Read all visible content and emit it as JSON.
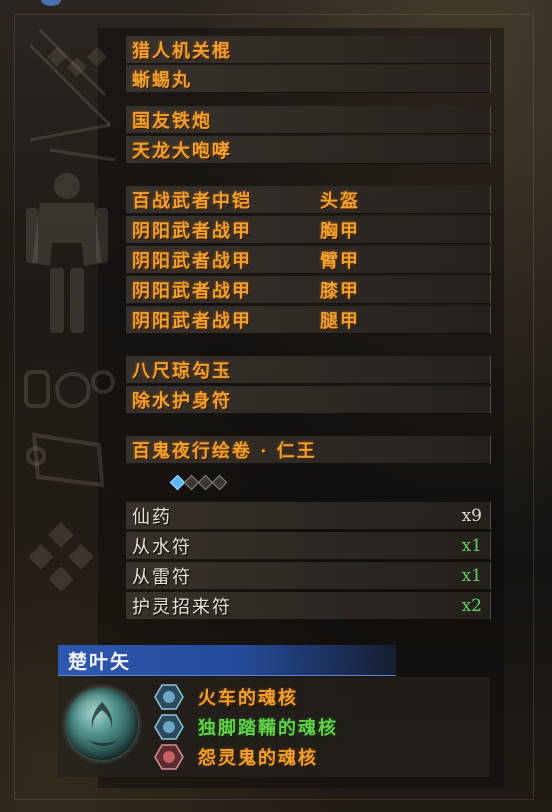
{
  "equipment": {
    "weapons_1": [
      "猎人机关棍",
      "蜥蜴丸"
    ],
    "weapons_2": [
      "国友铁炮",
      "天龙大咆哮"
    ],
    "armor": [
      {
        "name": "百战武者中铠",
        "slot": "头盔"
      },
      {
        "name": "阴阳武者战甲",
        "slot": "胸甲"
      },
      {
        "name": "阴阳武者战甲",
        "slot": "臂甲"
      },
      {
        "name": "阴阳武者战甲",
        "slot": "膝甲"
      },
      {
        "name": "阴阳武者战甲",
        "slot": "腿甲"
      }
    ],
    "accessories": [
      "八尺琼勾玉",
      "除水护身符"
    ],
    "scroll": "百鬼夜行绘卷 · 仁王",
    "scroll_pips": {
      "filled": 1,
      "total": 4
    }
  },
  "items": [
    {
      "name": "仙药",
      "count": "x9",
      "color": "#e0dcd4"
    },
    {
      "name": "从水符",
      "count": "x1",
      "color": "#5fd15f"
    },
    {
      "name": "从雷符",
      "count": "x1",
      "color": "#5fd15f"
    },
    {
      "name": "护灵招来符",
      "count": "x2",
      "color": "#5fd15f"
    }
  ],
  "guardian_spirit": {
    "name": "楚叶矢",
    "cores": [
      {
        "name": "火车的魂核",
        "color": "#f0a030",
        "gem": "blue"
      },
      {
        "name": "独脚踏鞴的魂核",
        "color": "#62d04a",
        "gem": "blue"
      },
      {
        "name": "怨灵鬼的魂核",
        "color": "#f0a030",
        "gem": "red"
      }
    ]
  }
}
